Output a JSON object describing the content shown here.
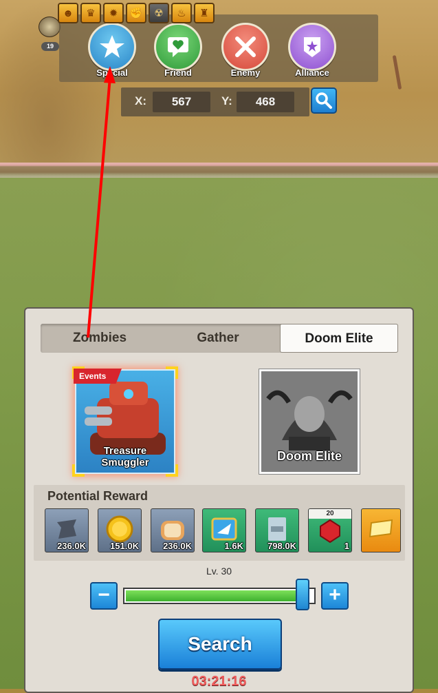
{
  "buffs": [
    {
      "icon": "ghost-head-icon",
      "style": "gold"
    },
    {
      "icon": "warrior-head-icon",
      "style": "gold"
    },
    {
      "icon": "explosion-icon",
      "style": "gold"
    },
    {
      "icon": "fist-icon",
      "style": "gold"
    },
    {
      "icon": "gas-mask-icon",
      "style": "dark"
    },
    {
      "icon": "flame-tower-icon",
      "style": "gold"
    },
    {
      "icon": "tower-icon",
      "style": "gold"
    }
  ],
  "player": {
    "level_badge": "19"
  },
  "filters": [
    {
      "label": "Special",
      "icon": "star-icon",
      "color": "#2a86c8"
    },
    {
      "label": "Friend",
      "icon": "heart-bubble-icon",
      "color": "#2f9b3a"
    },
    {
      "label": "Enemy",
      "icon": "crossed-swords-icon",
      "color": "#d64a3b"
    },
    {
      "label": "Alliance",
      "icon": "alliance-shield-icon",
      "color": "#8e50d1"
    }
  ],
  "coords": {
    "x_label": "X:",
    "x_value": "567",
    "y_label": "Y:",
    "y_value": "468"
  },
  "tabs": [
    {
      "label": "Zombies",
      "active": false
    },
    {
      "label": "Gather",
      "active": false
    },
    {
      "label": "Doom Elite",
      "active": true
    }
  ],
  "targets": {
    "treasure": {
      "tag": "Events",
      "name_line1": "Treasure",
      "name_line2": "Smuggler"
    },
    "doom": {
      "name": "Doom Elite"
    }
  },
  "reward": {
    "title": "Potential Reward",
    "items": [
      {
        "icon": "iron-ingot-icon",
        "qty": "236.0K",
        "style": "grey"
      },
      {
        "icon": "gold-coin-icon",
        "qty": "151.0K",
        "style": "grey"
      },
      {
        "icon": "bread-icon",
        "qty": "236.0K",
        "style": "grey"
      },
      {
        "icon": "speedup-plane-icon",
        "qty": "1.6K",
        "style": "green"
      },
      {
        "icon": "exp-book-icon",
        "qty": "798.0K",
        "style": "green"
      },
      {
        "icon": "ruby-icon",
        "qty": "1",
        "top": "20",
        "style": "green"
      },
      {
        "icon": "gold-ticket-icon",
        "qty": "",
        "style": "gold"
      }
    ]
  },
  "level": {
    "label": "Lv. 30",
    "fraction": 0.98
  },
  "search": {
    "label": "Search",
    "timer": "03:21:16"
  },
  "colors": {
    "accent": "#1f86d2",
    "arrow": "#ff0000",
    "timer": "#ef5c5c"
  }
}
